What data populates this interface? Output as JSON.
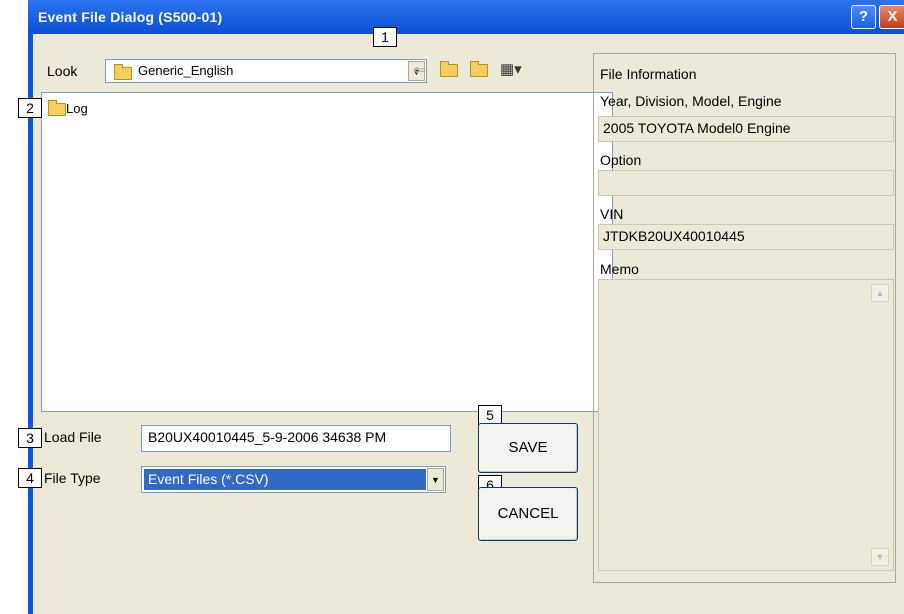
{
  "window": {
    "title": "Event File Dialog (S500-01)"
  },
  "titlebar": {
    "help_glyph": "?",
    "close_glyph": "X"
  },
  "look": {
    "label": "Look",
    "value": "Generic_English",
    "icon": "folder-icon",
    "toolbar_icons": [
      "back-arrow-icon",
      "up-folder-icon",
      "new-folder-icon",
      "view-menu-icon"
    ]
  },
  "filelist": {
    "items": [
      {
        "label": "Log",
        "icon": "folder-icon"
      }
    ]
  },
  "callouts": [
    "1",
    "2",
    "3",
    "4",
    "5",
    "6"
  ],
  "load_file": {
    "label": "Load File",
    "value": "B20UX40010445_5-9-2006 34638 PM"
  },
  "file_type": {
    "label": "File Type",
    "value": "Event Files (*.CSV)"
  },
  "buttons": {
    "save": "SAVE",
    "cancel": "CANCEL"
  },
  "file_info": {
    "heading": "File Information",
    "ydme_label": "Year, Division, Model, Engine",
    "ydme_value": "2005 TOYOTA Model0 Engine",
    "option_label": "Option",
    "option_value": "",
    "vin_label": "VIN",
    "vin_value": "JTDKB20UX40010445",
    "memo_label": "Memo"
  },
  "colors": {
    "titlebar": "#0a4fd3",
    "client": "#ece9d8",
    "selection": "#3169c6"
  }
}
